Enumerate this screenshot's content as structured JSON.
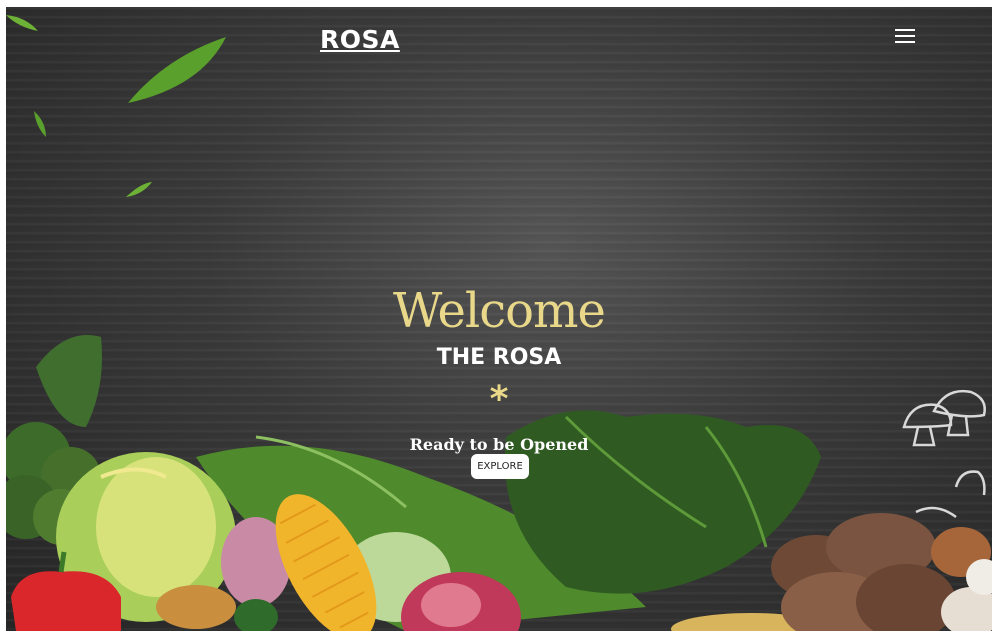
{
  "nav": {
    "brand": "ROSA",
    "menu_icon": "hamburger-menu-icon"
  },
  "hero": {
    "welcome": "Welcome",
    "subtitle": "THE ROSA",
    "divider": "*",
    "tagline": "Ready to be Opened",
    "cta_label": "EXPLORE"
  },
  "colors": {
    "accent": "#e9d88a",
    "background": "#3a3a3a",
    "text": "#ffffff"
  }
}
